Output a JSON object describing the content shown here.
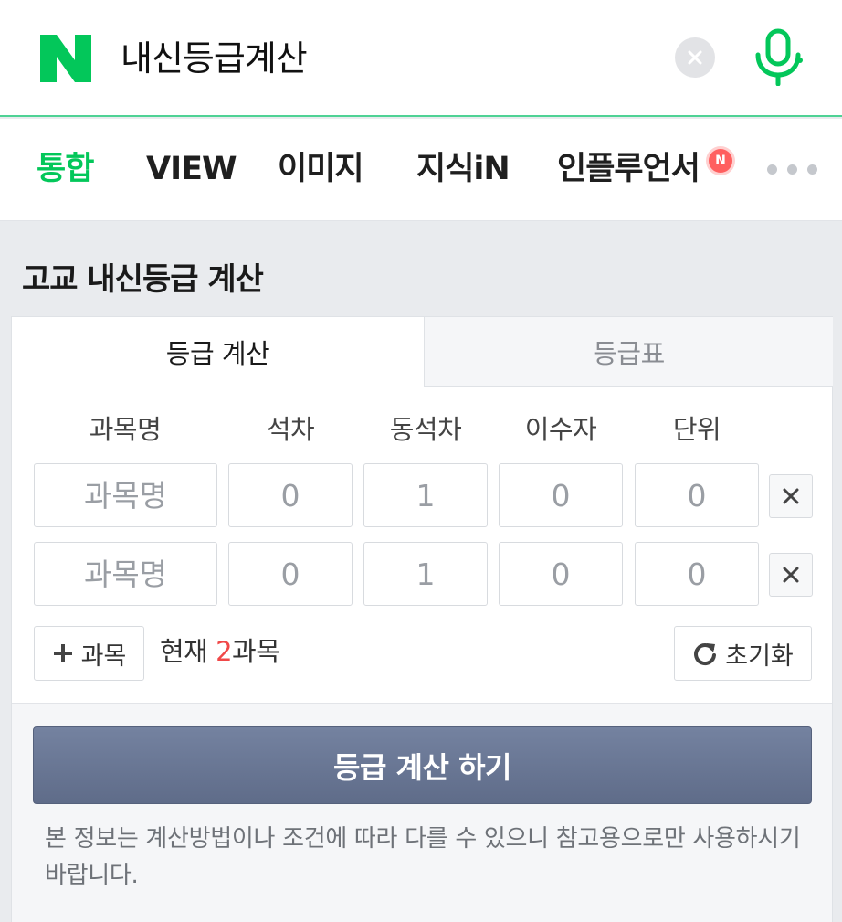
{
  "search": {
    "query": "내신등급계산",
    "logo_letter": "N"
  },
  "tabs": [
    {
      "label": "통합",
      "active": true
    },
    {
      "label": "VIEW",
      "active": false
    },
    {
      "label": "이미지",
      "active": false
    },
    {
      "label": "지식iN",
      "active": false
    },
    {
      "label": "인플루언서",
      "active": false,
      "badge": "N"
    }
  ],
  "section": {
    "title": "고교 내신등급 계산"
  },
  "calculator": {
    "tabs": [
      {
        "label": "등급 계산",
        "active": true
      },
      {
        "label": "등급표",
        "active": false
      }
    ],
    "columns": [
      "과목명",
      "석차",
      "동석차",
      "이수자",
      "단위"
    ],
    "rows": [
      {
        "subject_placeholder": "과목명",
        "rank": "0",
        "tied_rank": "1",
        "students": "0",
        "units": "0"
      },
      {
        "subject_placeholder": "과목명",
        "rank": "0",
        "tied_rank": "1",
        "students": "0",
        "units": "0"
      }
    ],
    "add_label": "과목",
    "count_prefix": "현재 ",
    "count_value": "2",
    "count_suffix": "과목",
    "reset_label": "초기화",
    "submit_label": "등급 계산 하기",
    "notice": "본 정보는 계산방법이나 조건에 따라 다를 수 있으니 참고용으로만 사용하시기 바랍니다."
  },
  "colors": {
    "brand_green": "#03c75a",
    "accent_red": "#f04848",
    "submit_button": "#6b7896"
  }
}
